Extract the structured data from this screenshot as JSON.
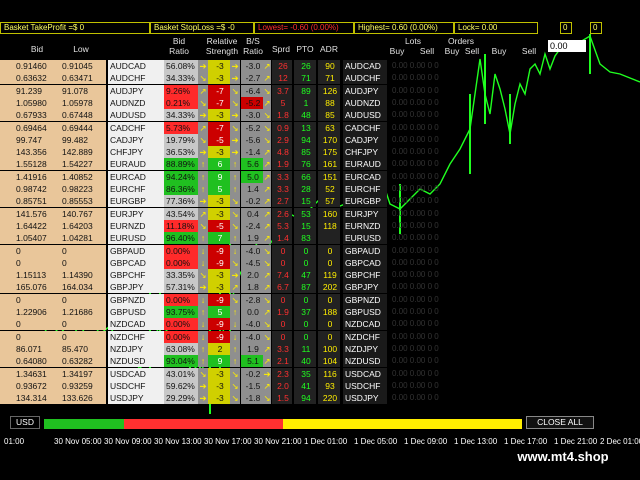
{
  "topbar": {
    "take_profit": "Basket TakeProfit =$ 0",
    "stop_loss": "Basket StopLoss =$ -0",
    "lowest": "Lowest= -0.60 (0.00%)",
    "highest": "Highest= 0.60 (0.00%)",
    "lock": "Lock= 0.00",
    "zero1": "0",
    "zero2": "0"
  },
  "headers": {
    "bid": "Bid",
    "low": "Low",
    "bid_ratio": "Bid\nRatio",
    "relative_strength": "Relative\nStrength",
    "bs_ratio": "B/S\nRatio",
    "sprd": "Sprd",
    "pto": "PTO",
    "adr": "ADR",
    "lots": "Lots",
    "orders": "Orders",
    "buy1": "Buy",
    "sell1": "Sell",
    "buy2": "Buy",
    "sell2": "Sell",
    "buy3": "Buy",
    "sell3": "Sell"
  },
  "input_value": "0.00",
  "rows": [
    {
      "left": "",
      "bid": "0.91460",
      "low": "0.91045",
      "sym": "AUDCAD",
      "ratio": "56.08%",
      "ratio_color": "#c8c8c8",
      "a1": "➔",
      "str": "-3",
      "str_color": "#d0d000",
      "a2": "➔",
      "bs": "-3.0",
      "bs_color": "#8f8f8f",
      "a3": "↗",
      "sprd": "26",
      "pto": "26",
      "adr": "90",
      "sym2": "AUDCAD"
    },
    {
      "left": "",
      "bid": "0.63632",
      "low": "0.63471",
      "sym": "AUDCHF",
      "ratio": "34.33%",
      "ratio_color": "#c8c8c8",
      "a1": "↘",
      "str": "-3",
      "str_color": "#d0d000",
      "a2": "➔",
      "bs": "-2.7",
      "bs_color": "#8f8f8f",
      "a3": "↗",
      "sprd": "12",
      "pto": "71",
      "adr": "71",
      "sym2": "AUDCHF"
    },
    {
      "left": "",
      "bid": "91.239",
      "low": "91.078",
      "sym": "AUDJPY",
      "ratio": "9.26%",
      "ratio_color": "#ff2a2a",
      "a1": "↗",
      "str": "-7",
      "str_color": "#cc0000",
      "a2": "↘",
      "bs": "-6.4",
      "bs_color": "#8f8f8f",
      "a3": "↘",
      "sprd": "3.7",
      "pto": "89",
      "adr": "126",
      "sym2": "AUDJPY"
    },
    {
      "left": "",
      "bid": "1.05980",
      "low": "1.05978",
      "sym": "AUDNZD",
      "ratio": "0.21%",
      "ratio_color": "#ff2a2a",
      "a1": "↘",
      "str": "-7",
      "str_color": "#cc0000",
      "a2": "↘",
      "bs": "-5.2",
      "bs_color": "#cc0000",
      "a3": "↗",
      "sprd": "5",
      "pto": "1",
      "adr": "88",
      "sym2": "AUDNZD"
    },
    {
      "left": "",
      "bid": "0.67933",
      "low": "0.67448",
      "sym": "AUDUSD",
      "ratio": "34.33%",
      "ratio_color": "#c8c8c8",
      "a1": "➔",
      "str": "-3",
      "str_color": "#d0d000",
      "a2": "➔",
      "bs": "-3.0",
      "bs_color": "#8f8f8f",
      "a3": "↘",
      "sprd": "1.8",
      "pto": "48",
      "adr": "85",
      "sym2": "AUDUSD"
    },
    {
      "left": "",
      "bid": "0.69464",
      "low": "0.69444",
      "sym": "CADCHF",
      "ratio": "5.73%",
      "ratio_color": "#ff2a2a",
      "a1": "↗",
      "str": "-7",
      "str_color": "#cc0000",
      "a2": "↘",
      "bs": "-5.2",
      "bs_color": "#8f8f8f",
      "a3": "↘",
      "sprd": "0.9",
      "pto": "13",
      "adr": "63",
      "sym2": "CADCHF"
    },
    {
      "left": "",
      "bid": "99.747",
      "low": "99.482",
      "sym": "CADJPY",
      "ratio": "19.79%",
      "ratio_color": "#c8c8c8",
      "a1": "↘",
      "str": "-5",
      "str_color": "#cc0000",
      "a2": "➔",
      "bs": "-5.6",
      "bs_color": "#8f8f8f",
      "a3": "↘",
      "sprd": "2.9",
      "pto": "94",
      "adr": "170",
      "sym2": "CADJPY"
    },
    {
      "left": "",
      "bid": "143.356",
      "low": "142.889",
      "sym": "CHFJPY",
      "ratio": "36.53%",
      "ratio_color": "#c8c8c8",
      "a1": "➔",
      "str": "-3",
      "str_color": "#d0d000",
      "a2": "➔",
      "bs": "-1.4",
      "bs_color": "#8f8f8f",
      "a3": "↗",
      "sprd": "4.8",
      "pto": "85",
      "adr": "175",
      "sym2": "CHFJPY"
    },
    {
      "left": "",
      "bid": "1.55128",
      "low": "1.54227",
      "sym": "EURAUD",
      "ratio": "88.89%",
      "ratio_color": "#20c020",
      "a1": "↑",
      "str": "6",
      "str_color": "#20c020",
      "a2": "↑",
      "bs": "5.6",
      "bs_color": "#20c020",
      "a3": "↗",
      "sprd": "1.9",
      "pto": "76",
      "adr": "161",
      "sym2": "EURAUD"
    },
    {
      "left": "",
      "bid": "1.41916",
      "low": "1.40852",
      "sym": "EURCAD",
      "ratio": "94.24%",
      "ratio_color": "#20c020",
      "a1": "↑",
      "str": "9",
      "str_color": "#20c020",
      "a2": "↑",
      "bs": "5.0",
      "bs_color": "#20c020",
      "a3": "↗",
      "sprd": "3.3",
      "pto": "66",
      "adr": "151",
      "sym2": "EURCAD"
    },
    {
      "left": "",
      "bid": "0.98742",
      "low": "0.98223",
      "sym": "EURCHF",
      "ratio": "86.36%",
      "ratio_color": "#20c020",
      "a1": "↑",
      "str": "5",
      "str_color": "#20c020",
      "a2": "↑",
      "bs": "1.4",
      "bs_color": "#8f8f8f",
      "a3": "↗",
      "sprd": "3.3",
      "pto": "28",
      "adr": "52",
      "sym2": "EURCHF"
    },
    {
      "left": "",
      "bid": "0.85751",
      "low": "0.85553",
      "sym": "EURGBP",
      "ratio": "77.36%",
      "ratio_color": "#c8c8c8",
      "a1": "➔",
      "str": "-3",
      "str_color": "#d0d000",
      "a2": "↘",
      "bs": "-0.2",
      "bs_color": "#8f8f8f",
      "a3": "↗",
      "sprd": "2.7",
      "pto": "15",
      "adr": "57",
      "sym2": "EURGBP"
    },
    {
      "left": "",
      "bid": "141.576",
      "low": "140.767",
      "sym": "EURJPY",
      "ratio": "43.54%",
      "ratio_color": "#c8c8c8",
      "a1": "↗",
      "str": "-3",
      "str_color": "#d0d000",
      "a2": "↘",
      "bs": "0.4",
      "bs_color": "#8f8f8f",
      "a3": "↗",
      "sprd": "2.6",
      "pto": "53",
      "adr": "160",
      "sym2": "EURJPY"
    },
    {
      "left": "",
      "bid": "1.64422",
      "low": "1.64203",
      "sym": "EURNZD",
      "ratio": "11.18%",
      "ratio_color": "#ff2a2a",
      "a1": "↘",
      "str": "-5",
      "str_color": "#cc0000",
      "a2": "↘",
      "bs": "-2.4",
      "bs_color": "#8f8f8f",
      "a3": "↗",
      "sprd": "5.3",
      "pto": "15",
      "adr": "118",
      "sym2": "EURNZD"
    },
    {
      "left": "",
      "bid": "1.05407",
      "low": "1.04281",
      "sym": "EURUSD",
      "ratio": "96.40%",
      "ratio_color": "#20c020",
      "a1": "↑",
      "str": "7",
      "str_color": "#20c020",
      "a2": "↑",
      "bs": "1.9",
      "bs_color": "#8f8f8f",
      "a3": "↗",
      "sprd": "1.4",
      "pto": "83",
      "adr": "",
      "sym2": "EURUSD"
    },
    {
      "left": "",
      "bid": "0",
      "low": "0",
      "sym": "GBPAUD",
      "ratio": "0.00%",
      "ratio_color": "#ff2a2a",
      "a1": "↓",
      "str": "-9",
      "str_color": "#cc0000",
      "a2": "↓",
      "bs": "-4.0",
      "bs_color": "#8f8f8f",
      "a3": "↘",
      "sprd": "0",
      "pto": "0",
      "adr": "0",
      "sym2": "GBPAUD"
    },
    {
      "left": "",
      "bid": "0",
      "low": "0",
      "sym": "GBPCAD",
      "ratio": "0.00%",
      "ratio_color": "#ff2a2a",
      "a1": "↓",
      "str": "-9",
      "str_color": "#cc0000",
      "a2": "↘",
      "bs": "-4.5",
      "bs_color": "#8f8f8f",
      "a3": "↘",
      "sprd": "0",
      "pto": "0",
      "adr": "0",
      "sym2": "GBPCAD"
    },
    {
      "left": "",
      "bid": "1.15113",
      "low": "1.14390",
      "sym": "GBPCHF",
      "ratio": "33.35%",
      "ratio_color": "#c8c8c8",
      "a1": "↘",
      "str": "-3",
      "str_color": "#d0d000",
      "a2": "➔",
      "bs": "2.0",
      "bs_color": "#8f8f8f",
      "a3": "↗",
      "sprd": "7.4",
      "pto": "47",
      "adr": "119",
      "sym2": "GBPCHF"
    },
    {
      "left": "",
      "bid": "165.076",
      "low": "164.034",
      "sym": "GBPJPY",
      "ratio": "57.31%",
      "ratio_color": "#c8c8c8",
      "a1": "➔",
      "str": "-3",
      "str_color": "#d0d000",
      "a2": "↗",
      "bs": "1.8",
      "bs_color": "#8f8f8f",
      "a3": "↗",
      "sprd": "6.7",
      "pto": "87",
      "adr": "202",
      "sym2": "GBPJPY"
    },
    {
      "left": "",
      "bid": "0",
      "low": "0",
      "sym": "GBPNZD",
      "ratio": "0.00%",
      "ratio_color": "#ff2a2a",
      "a1": "↓",
      "str": "-9",
      "str_color": "#cc0000",
      "a2": "↘",
      "bs": "-2.8",
      "bs_color": "#8f8f8f",
      "a3": "↘",
      "sprd": "0",
      "pto": "0",
      "adr": "0",
      "sym2": "GBPNZD"
    },
    {
      "left": "",
      "bid": "1.22906",
      "low": "1.21686",
      "sym": "GBPUSD",
      "ratio": "93.75%",
      "ratio_color": "#20c020",
      "a1": "↑",
      "str": "5",
      "str_color": "#20c020",
      "a2": "↑",
      "bs": "0.0",
      "bs_color": "#8f8f8f",
      "a3": "↗",
      "sprd": "1.9",
      "pto": "37",
      "adr": "188",
      "sym2": "GBPUSD"
    },
    {
      "left": "",
      "bid": "0",
      "low": "0",
      "sym": "NZDCAD",
      "ratio": "0.00%",
      "ratio_color": "#ff2a2a",
      "a1": "↓",
      "str": "-9",
      "str_color": "#cc0000",
      "a2": "↓",
      "bs": "-4.0",
      "bs_color": "#8f8f8f",
      "a3": "↘",
      "sprd": "0",
      "pto": "0",
      "adr": "0",
      "sym2": "NZDCAD"
    },
    {
      "left": "",
      "bid": "0",
      "low": "0",
      "sym": "NZDCHF",
      "ratio": "0.00%",
      "ratio_color": "#ff2a2a",
      "a1": "↓",
      "str": "-9",
      "str_color": "#cc0000",
      "a2": "↓",
      "bs": "-4.0",
      "bs_color": "#8f8f8f",
      "a3": "↘",
      "sprd": "0",
      "pto": "0",
      "adr": "0",
      "sym2": "NZDCHF"
    },
    {
      "left": "",
      "bid": "86.071",
      "low": "85.470",
      "sym": "NZDJPY",
      "ratio": "63.08%",
      "ratio_color": "#c8c8c8",
      "a1": "↑",
      "str": "2",
      "str_color": "#d0d000",
      "a2": "↑",
      "bs": "1.9",
      "bs_color": "#8f8f8f",
      "a3": "↗",
      "sprd": "3.3",
      "pto": "11",
      "adr": "100",
      "sym2": "NZDJPY"
    },
    {
      "left": "",
      "bid": "0.64080",
      "low": "0.63282",
      "sym": "NZDUSD",
      "ratio": "93.04%",
      "ratio_color": "#20c020",
      "a1": "↑",
      "str": "9",
      "str_color": "#20c020",
      "a2": "↑",
      "bs": "5.1",
      "bs_color": "#20c020",
      "a3": "↗",
      "sprd": "2.1",
      "pto": "40",
      "adr": "104",
      "sym2": "NZDUSD"
    },
    {
      "left": "",
      "bid": "1.34631",
      "low": "1.34197",
      "sym": "USDCAD",
      "ratio": "43.01%",
      "ratio_color": "#c8c8c8",
      "a1": "↘",
      "str": "-3",
      "str_color": "#d0d000",
      "a2": "↘",
      "bs": "-0.2",
      "bs_color": "#8f8f8f",
      "a3": "➔",
      "sprd": "2.3",
      "pto": "35",
      "adr": "116",
      "sym2": "USDCAD"
    },
    {
      "left": "",
      "bid": "0.93672",
      "low": "0.93259",
      "sym": "USDCHF",
      "ratio": "59.62%",
      "ratio_color": "#c8c8c8",
      "a1": "➔",
      "str": "-3",
      "str_color": "#d0d000",
      "a2": "↘",
      "bs": "-1.5",
      "bs_color": "#8f8f8f",
      "a3": "↗",
      "sprd": "2.0",
      "pto": "41",
      "adr": "93",
      "sym2": "USDCHF"
    },
    {
      "left": "",
      "bid": "134.314",
      "low": "133.626",
      "sym": "USDJPY",
      "ratio": "29.29%",
      "ratio_color": "#c8c8c8",
      "a1": "➔",
      "str": "-3",
      "str_color": "#d0d000",
      "a2": "↘",
      "bs": "-1.8",
      "bs_color": "#8f8f8f",
      "a3": "↘",
      "sprd": "1.5",
      "pto": "94",
      "adr": "220",
      "sym2": "USDJPY"
    }
  ],
  "lots_placeholder": "0.00       0.00       0       0",
  "usd_button": "USD",
  "close_all": "CLOSE ALL",
  "currency_strip": [
    "#20c020",
    "#20c020",
    "#ff3030",
    "#ff3030",
    "#ff3030",
    "#ff3030",
    "#ffee00",
    "#ffee00",
    "#ffee00",
    "#ffee00",
    "#ffee00",
    "#ffee00"
  ],
  "time_axis": [
    "01:00",
    "30 Nov 05:00",
    "30 Nov 09:00",
    "30 Nov 13:00",
    "30 Nov 17:00",
    "30 Nov 21:00",
    "1 Dec 01:00",
    "1 Dec 05:00",
    "1 Dec 09:00",
    "1 Dec 13:00",
    "1 Dec 17:00",
    "1 Dec 21:00",
    "2 Dec 01:00"
  ],
  "watermark": "www.mt4.shop"
}
